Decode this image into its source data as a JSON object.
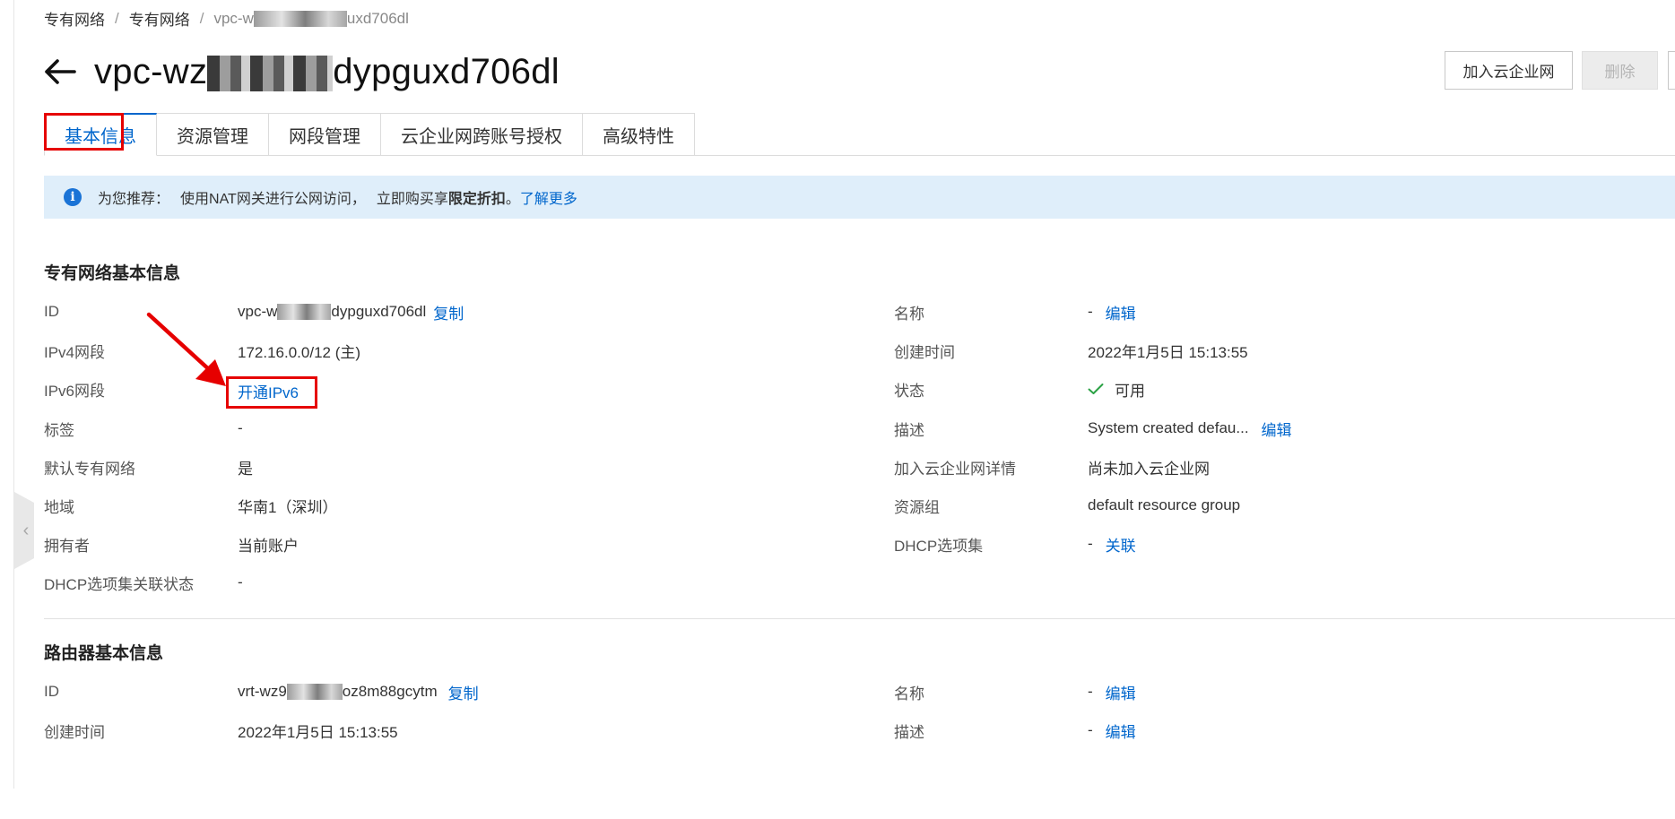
{
  "breadcrumb": {
    "item1": "专有网络",
    "item2": "专有网络",
    "separator": "/",
    "current_start": "vpc-w",
    "current_end": "uxd706dl"
  },
  "header": {
    "title_start": "vpc-wz",
    "title_end": "dypguxd706dl",
    "join_button": "加入云企业网",
    "delete_button": "删除"
  },
  "tabs": [
    {
      "label": "基本信息",
      "active": true
    },
    {
      "label": "资源管理",
      "active": false
    },
    {
      "label": "网段管理",
      "active": false
    },
    {
      "label": "云企业网跨账号授权",
      "active": false
    },
    {
      "label": "高级特性",
      "active": false
    }
  ],
  "notice": {
    "prefix": "为您推荐：",
    "text1": "使用NAT网关进行公网访问，",
    "text2": "立即购买享",
    "bold": "限定折扣",
    "period": "。",
    "link": "了解更多"
  },
  "vpc_info": {
    "section_title": "专有网络基本信息",
    "left": {
      "id_label": "ID",
      "id_start": "vpc-w",
      "id_end": "dypguxd706dl",
      "copy_link": "复制",
      "ipv4_label": "IPv4网段",
      "ipv4_value": "172.16.0.0/12 (主)",
      "ipv6_label": "IPv6网段",
      "ipv6_link": "开通IPv6",
      "tag_label": "标签",
      "tag_value": "-",
      "default_label": "默认专有网络",
      "default_value": "是",
      "region_label": "地域",
      "region_value": "华南1（深圳）",
      "owner_label": "拥有者",
      "owner_value": "当前账户",
      "dhcp_status_label": "DHCP选项集关联状态",
      "dhcp_status_value": "-"
    },
    "right": {
      "name_label": "名称",
      "name_value": "-",
      "name_edit": "编辑",
      "created_label": "创建时间",
      "created_value": "2022年1月5日 15:13:55",
      "status_label": "状态",
      "status_value": "可用",
      "desc_label": "描述",
      "desc_value": "System created defau...",
      "desc_edit": "编辑",
      "cen_label": "加入云企业网详情",
      "cen_value": "尚未加入云企业网",
      "rg_label": "资源组",
      "rg_value": "default resource group",
      "dhcp_label": "DHCP选项集",
      "dhcp_value": "-",
      "dhcp_link": "关联"
    }
  },
  "router_info": {
    "section_title": "路由器基本信息",
    "id_label": "ID",
    "id_start": "vrt-wz9",
    "id_end": "oz8m88gcytm",
    "copy_link": "复制",
    "created_label": "创建时间",
    "created_value": "2022年1月5日 15:13:55",
    "name_label": "名称",
    "name_value": "-",
    "name_edit": "编辑",
    "desc_label": "描述",
    "desc_value": "-",
    "desc_edit": "编辑"
  },
  "colors": {
    "link": "#0066cc",
    "highlight": "#e60000",
    "notice_bg": "#dfeefa",
    "success": "#2ba245"
  },
  "icons": [
    "back-arrow-icon",
    "info-icon",
    "check-icon",
    "chevron-left-icon"
  ]
}
